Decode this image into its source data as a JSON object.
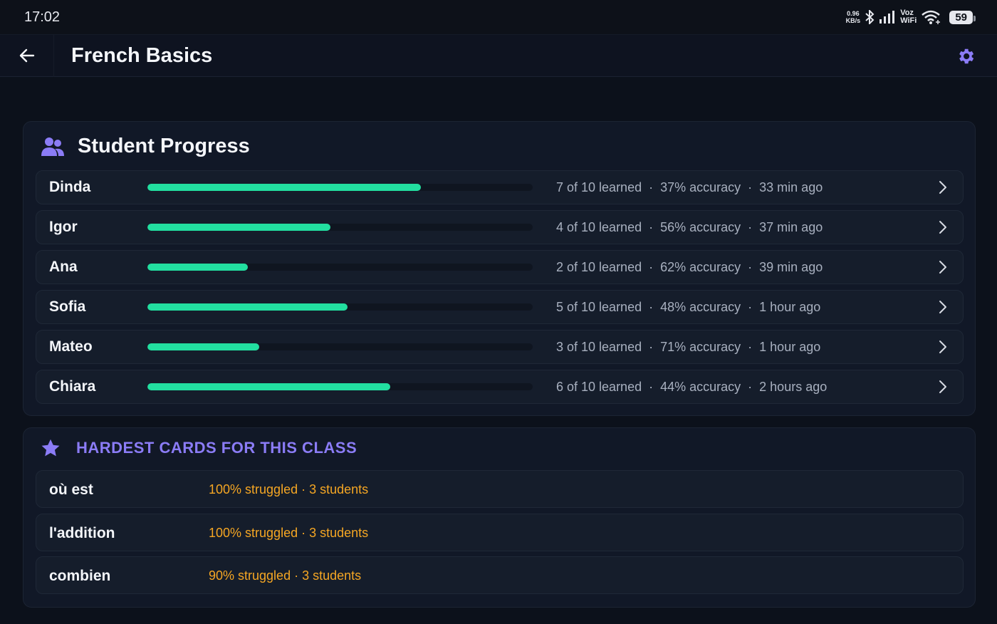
{
  "status": {
    "time": "17:02",
    "net_speed_value": "0.96",
    "net_speed_unit": "KB/s",
    "voz_top": "Voz",
    "voz_bottom": "WiFi",
    "battery": "59"
  },
  "appbar": {
    "title": "French Basics",
    "accent": "#8b7cf6"
  },
  "progress": {
    "title": "Student Progress",
    "bar_color": "#22dfa0",
    "students": [
      {
        "name": "Dinda",
        "progress": 0.71,
        "learned": "7 of 10 learned",
        "accuracy": "37% accuracy",
        "last_seen": "33 min ago"
      },
      {
        "name": "Igor",
        "progress": 0.475,
        "learned": "4 of 10 learned",
        "accuracy": "56% accuracy",
        "last_seen": "37 min ago"
      },
      {
        "name": "Ana",
        "progress": 0.26,
        "learned": "2 of 10 learned",
        "accuracy": "62% accuracy",
        "last_seen": "39 min ago"
      },
      {
        "name": "Sofia",
        "progress": 0.52,
        "learned": "5 of 10 learned",
        "accuracy": "48% accuracy",
        "last_seen": "1 hour ago"
      },
      {
        "name": "Mateo",
        "progress": 0.29,
        "learned": "3 of 10 learned",
        "accuracy": "71% accuracy",
        "last_seen": "1 hour ago"
      },
      {
        "name": "Chiara",
        "progress": 0.63,
        "learned": "6 of 10 learned",
        "accuracy": "44% accuracy",
        "last_seen": "2 hours ago"
      }
    ]
  },
  "hardest": {
    "title": "HARDEST CARDS FOR THIS CLASS",
    "stat_color": "#f5a623",
    "cards": [
      {
        "word": "où est",
        "struggled": "100% struggled",
        "students": "3 students"
      },
      {
        "word": "l'addition",
        "struggled": "100% struggled",
        "students": "3 students"
      },
      {
        "word": "combien",
        "struggled": "90% struggled",
        "students": "3 students"
      }
    ]
  }
}
